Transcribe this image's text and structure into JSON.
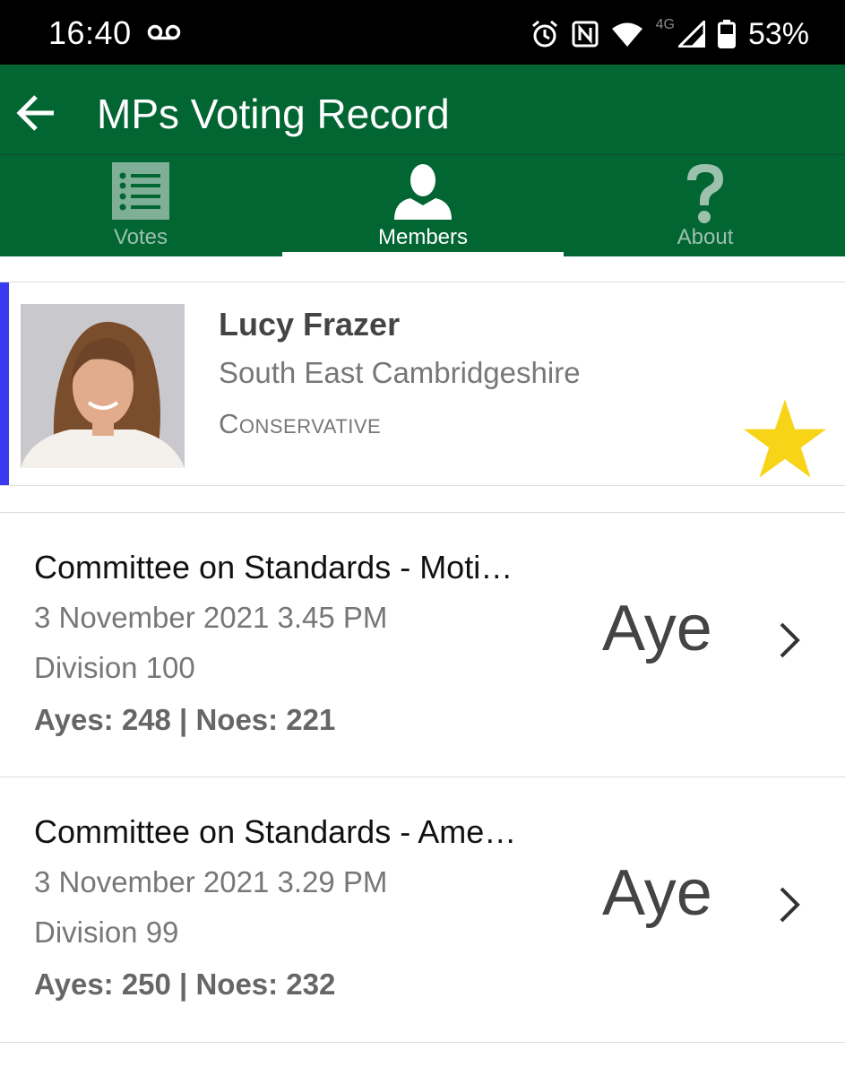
{
  "status_bar": {
    "time": "16:40",
    "network": "4G",
    "battery": "53%",
    "icons": [
      "voicemail-icon",
      "alarm-icon",
      "nfc-icon",
      "wifi-icon",
      "signal-icon",
      "battery-icon"
    ]
  },
  "app_bar": {
    "title": "MPs Voting Record",
    "back_icon": "arrow-back-icon",
    "color": "#026633"
  },
  "tabs": [
    {
      "label": "Votes",
      "icon": "list-icon",
      "active": false
    },
    {
      "label": "Members",
      "icon": "person-icon",
      "active": true
    },
    {
      "label": "About",
      "icon": "question-icon",
      "active": false
    }
  ],
  "member": {
    "name": "Lucy Frazer",
    "constituency": "South East Cambridgeshire",
    "party": "Conservative",
    "party_color": "#3a3af0",
    "favorite": true,
    "favorite_color": "#f7d417"
  },
  "votes": [
    {
      "title": "Committee on Standards - Moti…",
      "date": "3 November 2021 3.45 PM",
      "division": "Division 100",
      "counts": "Ayes: 248 | Noes: 221",
      "result": "Aye"
    },
    {
      "title": "Committee on Standards - Ame…",
      "date": "3 November 2021 3.29 PM",
      "division": "Division 99",
      "counts": "Ayes: 250 | Noes: 232",
      "result": "Aye"
    }
  ]
}
